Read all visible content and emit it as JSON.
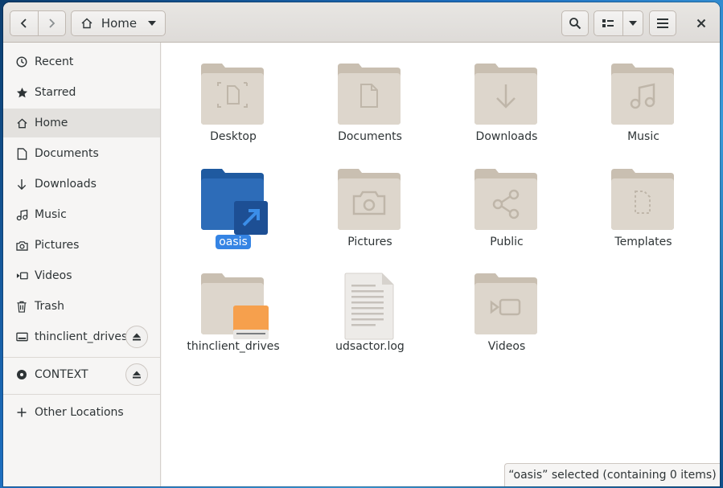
{
  "header": {
    "path_label": "Home",
    "back_icon": "chevron-left-icon",
    "forward_icon": "chevron-right-icon",
    "search_icon": "search-icon",
    "view_icon": "list-view-icon",
    "menu_icon": "hamburger-menu-icon",
    "close_icon": "close-icon"
  },
  "sidebar": {
    "items": [
      {
        "label": "Recent",
        "icon": "clock-icon"
      },
      {
        "label": "Starred",
        "icon": "star-icon"
      },
      {
        "label": "Home",
        "icon": "home-icon",
        "active": true
      },
      {
        "label": "Documents",
        "icon": "document-icon"
      },
      {
        "label": "Downloads",
        "icon": "download-icon"
      },
      {
        "label": "Music",
        "icon": "music-icon"
      },
      {
        "label": "Pictures",
        "icon": "camera-icon"
      },
      {
        "label": "Videos",
        "icon": "video-icon"
      },
      {
        "label": "Trash",
        "icon": "trash-icon"
      },
      {
        "label": "thinclient_drives",
        "icon": "drive-icon"
      },
      {
        "label": "CONTEXT",
        "icon": "disc-icon"
      },
      {
        "label": "Other Locations",
        "icon": "plus-icon"
      }
    ]
  },
  "files": [
    {
      "name": "Desktop",
      "icon": "folder-desktop-icon"
    },
    {
      "name": "Documents",
      "icon": "folder-documents-icon"
    },
    {
      "name": "Downloads",
      "icon": "folder-download-icon"
    },
    {
      "name": "Music",
      "icon": "folder-music-icon"
    },
    {
      "name": "oasis",
      "icon": "folder-link-icon",
      "selected": true
    },
    {
      "name": "Pictures",
      "icon": "folder-pictures-icon"
    },
    {
      "name": "Public",
      "icon": "folder-share-icon"
    },
    {
      "name": "Templates",
      "icon": "folder-templates-icon"
    },
    {
      "name": "thinclient_drives",
      "icon": "folder-drive-icon"
    },
    {
      "name": "udsactor.log",
      "icon": "text-file-icon"
    },
    {
      "name": "Videos",
      "icon": "folder-videos-icon"
    }
  ],
  "status": "“oasis” selected  (containing 0 items)",
  "colors": {
    "selection": "#3584e4",
    "folder": "#d8d1c7",
    "folder_link": "#2a66b0",
    "drive_orange": "#f6a04d"
  }
}
